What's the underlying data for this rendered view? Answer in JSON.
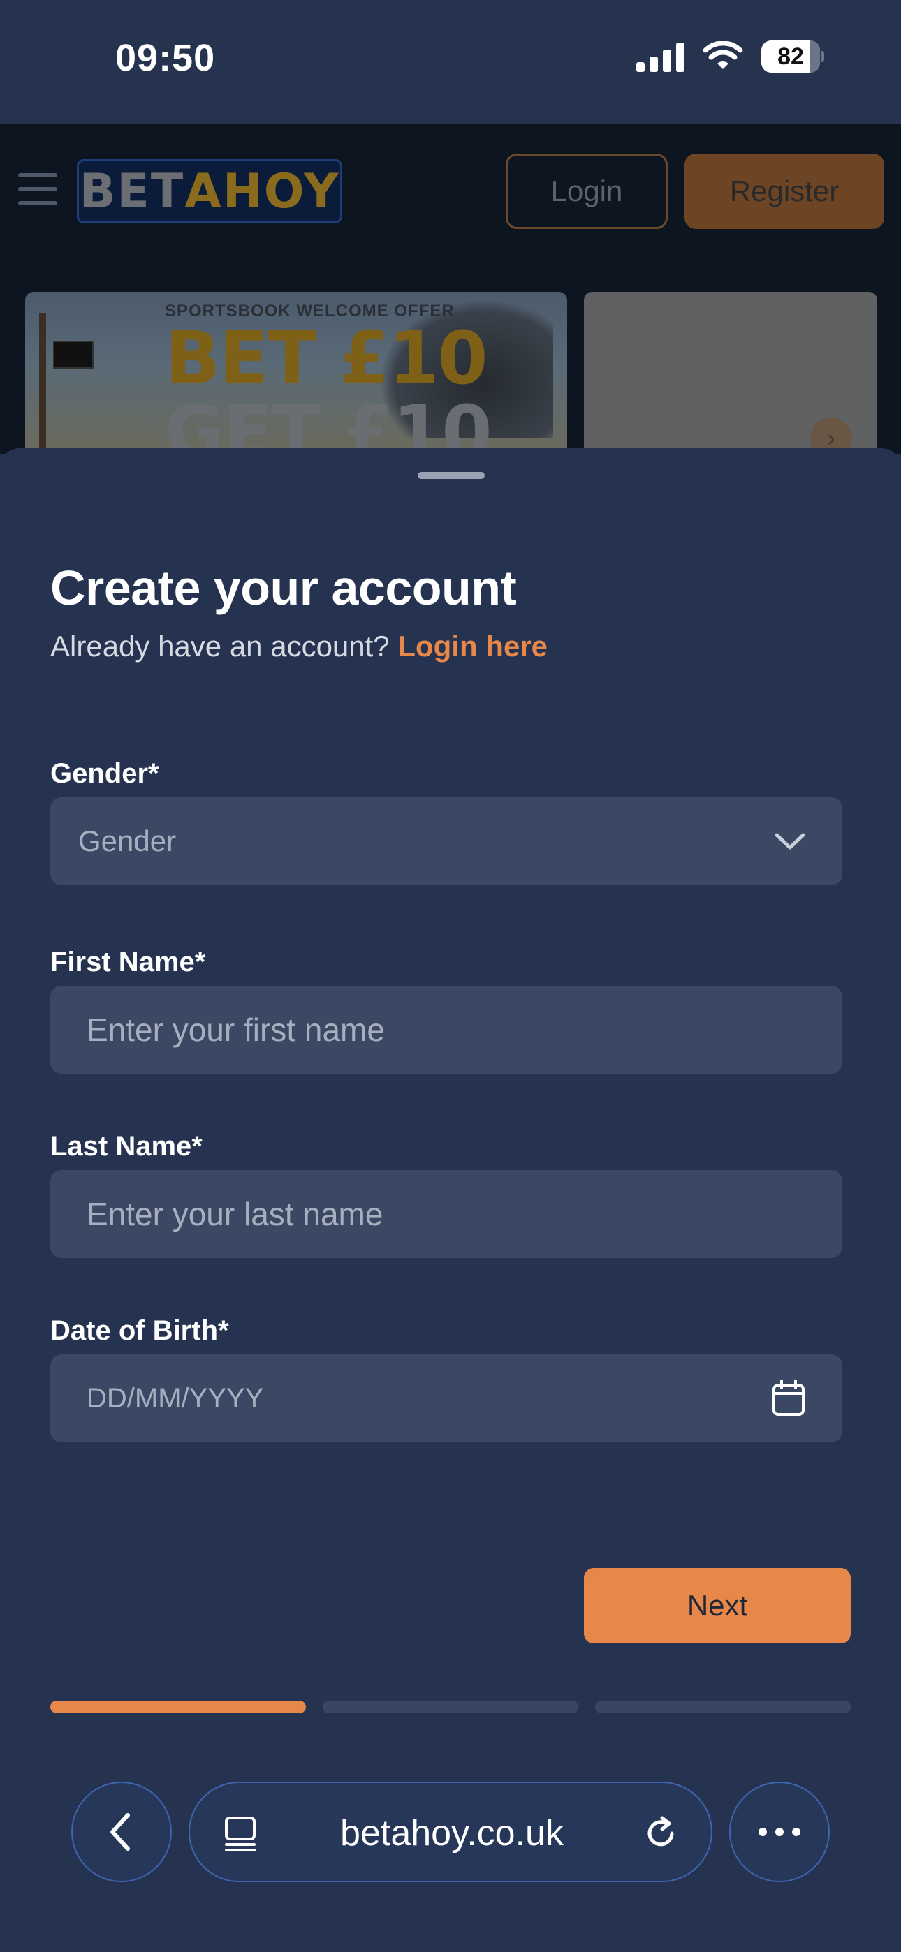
{
  "status_bar": {
    "time": "09:50",
    "battery": "82",
    "battery_level": 0.82
  },
  "site_header": {
    "logo_part1": "BET",
    "logo_part2": "AHOY",
    "login_label": "Login",
    "register_label": "Register"
  },
  "banner": {
    "offer_caption": "SPORTSBOOK WELCOME OFFER",
    "headline_line1": "BET £10",
    "headline_line2": "GET £10"
  },
  "form": {
    "title": "Create your account",
    "subtitle": "Already have an account?",
    "login_link": "Login here",
    "gender": {
      "label": "Gender*",
      "value": "Gender"
    },
    "first_name": {
      "label": "First Name*",
      "placeholder": "Enter your first name"
    },
    "last_name": {
      "label": "Last Name*",
      "placeholder": "Enter your last name"
    },
    "dob": {
      "label": "Date of Birth*",
      "placeholder": "DD/MM/YYYY"
    },
    "next_label": "Next",
    "progress": {
      "current_step": 1,
      "total_steps": 3
    }
  },
  "browser": {
    "url": "betahoy.co.uk"
  },
  "colors": {
    "accent": "#e8874a",
    "background": "#253350",
    "field": "#3b4863"
  },
  "icons": [
    "menu-icon",
    "signal-icon",
    "wifi-icon",
    "battery-icon",
    "chevron-down-icon",
    "calendar-icon",
    "back-icon",
    "tabs-icon",
    "reload-icon",
    "more-icon"
  ]
}
